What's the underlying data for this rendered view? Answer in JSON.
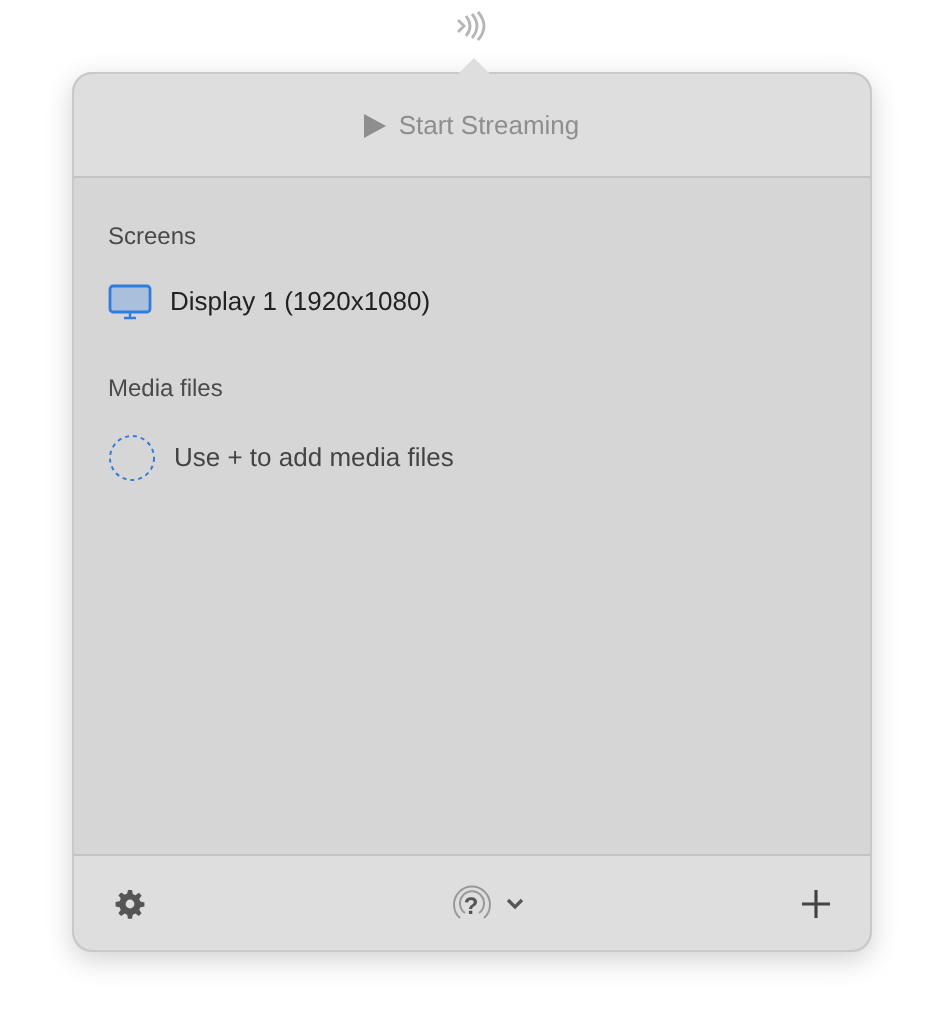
{
  "header": {
    "action": "Start Streaming",
    "disabled": true
  },
  "sections": [
    {
      "title": "Screens",
      "items": [
        {
          "kind": "display",
          "label": "Display 1 (1920x1080)"
        }
      ]
    },
    {
      "title": "Media files",
      "items": [
        {
          "kind": "placeholder",
          "label": "Use + to add media files"
        }
      ]
    }
  ],
  "footer": {
    "device_symbol": "?"
  }
}
